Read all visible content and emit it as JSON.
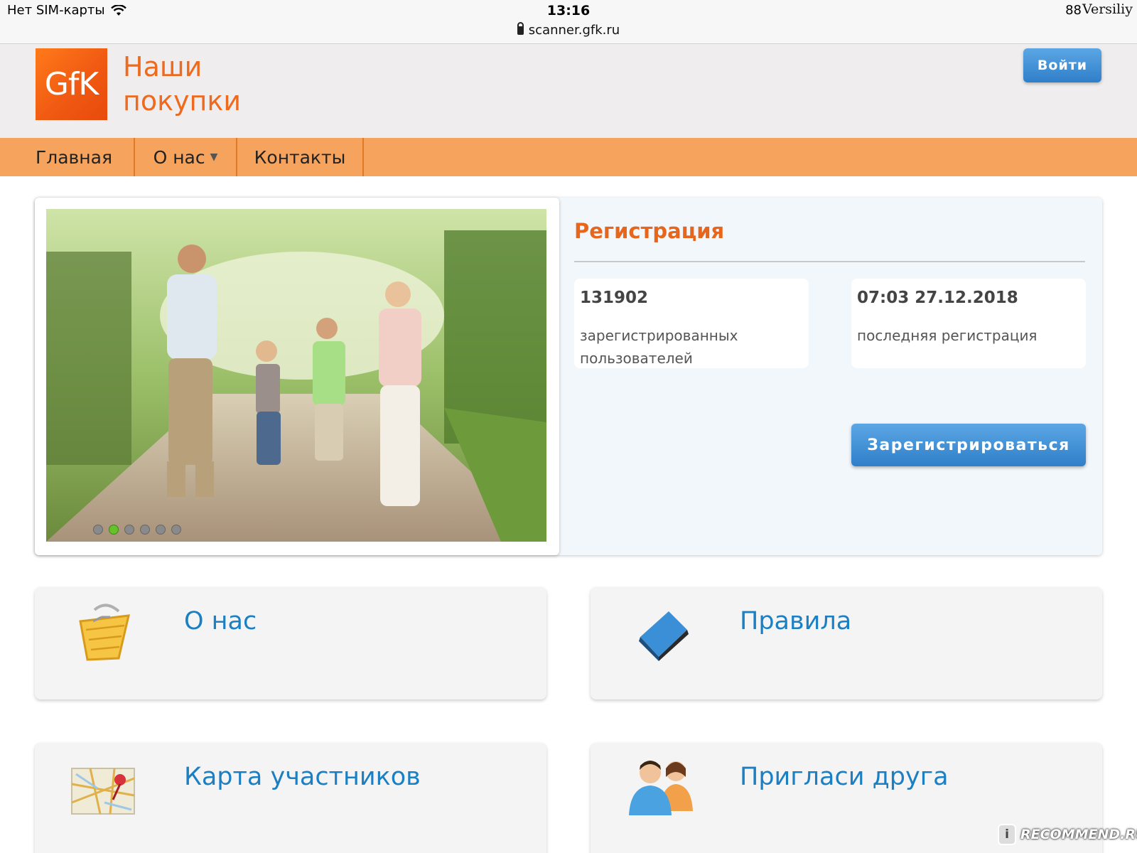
{
  "status_bar": {
    "carrier": "Нет SIM-карты",
    "time": "13:16",
    "url": "scanner.gfk.ru",
    "battery": "88",
    "watermark": "Versiliy"
  },
  "header": {
    "logo_text": "GfK",
    "brand_line1": "Наши",
    "brand_line2": "покупки",
    "login_label": "Войти"
  },
  "nav": {
    "items": [
      {
        "label": "Главная"
      },
      {
        "label": "О нас"
      },
      {
        "label": "Контакты"
      }
    ]
  },
  "slider": {
    "dot_count": 6,
    "active_dot": 1
  },
  "registration": {
    "title": "Регистрация",
    "users_count": "131902",
    "users_label": "зарегистрированных пользователей",
    "last_time": "07:03 27.12.2018",
    "last_label": "последняя регистрация",
    "register_label": "Зарегистрироваться"
  },
  "tiles": [
    {
      "label": "О нас",
      "icon": "basket-icon"
    },
    {
      "label": "Правила",
      "icon": "book-icon"
    },
    {
      "label": "Карта участников",
      "icon": "map-pin-icon"
    },
    {
      "label": "Пригласи друга",
      "icon": "people-icon"
    }
  ],
  "watermark": {
    "text": "RECOMMEND.RU",
    "badge": "i"
  },
  "colors": {
    "accent_orange": "#ee6a1e",
    "nav_orange": "#f5a35d",
    "button_blue": "#3b8ad2",
    "link_blue": "#1b7fc4"
  }
}
